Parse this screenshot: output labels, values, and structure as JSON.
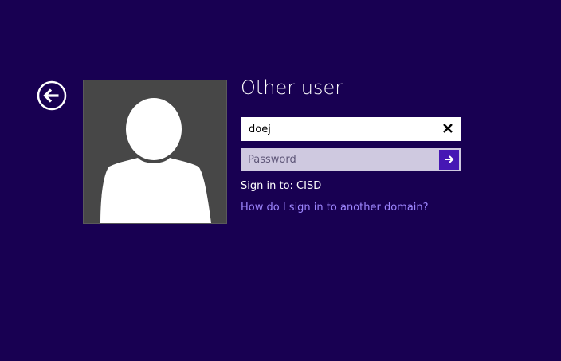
{
  "colors": {
    "background": "#180052",
    "accent": "#4617b4",
    "link": "#9e86ff",
    "avatar_tile": "#474747"
  },
  "icons": {
    "back": "arrow-left-circle",
    "avatar": "user-silhouette",
    "clear": "close-x",
    "submit": "arrow-right"
  },
  "login": {
    "title": "Other user",
    "username_value": "doej",
    "password_placeholder": "Password",
    "sign_in_to": "Sign in to: CISD",
    "domain_link": "How do I sign in to another domain?"
  }
}
